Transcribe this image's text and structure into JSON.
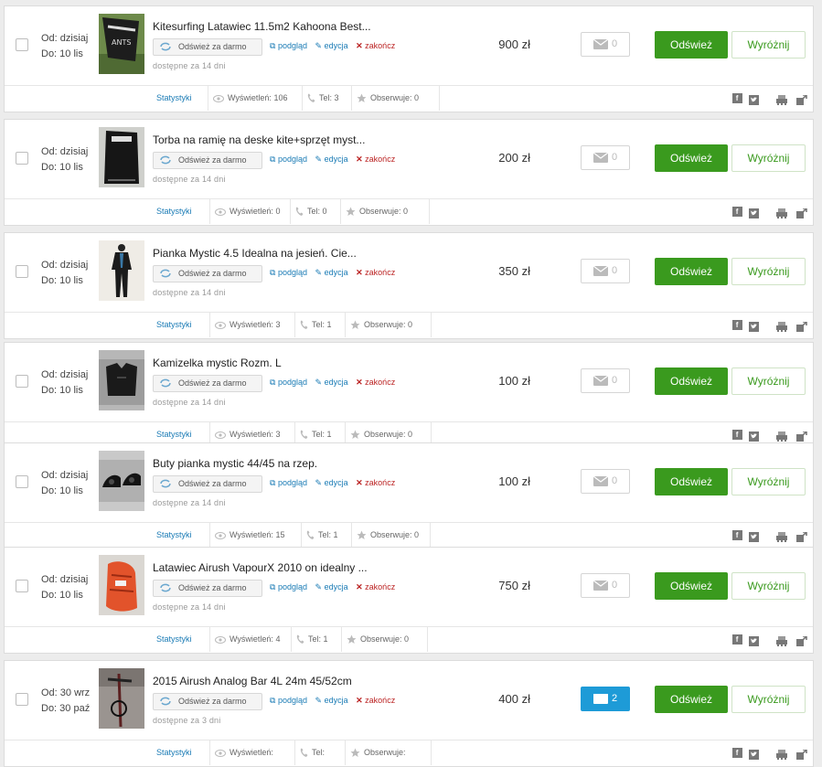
{
  "labels": {
    "refresh_free": "Odśwież za darmo",
    "preview": "podgląd",
    "edit": "edycja",
    "end": "zakończ",
    "refresh_btn": "Odśwież",
    "feature_btn": "Wyróżnij",
    "stats_link": "Statystyki",
    "views_label": "Wyświetleń:",
    "phone_label": "Tel:",
    "watch_label": "Obserwuje:",
    "facebook_glyph": "f"
  },
  "colors": {
    "refresh_green": "#3a9a1e",
    "message_blue": "#1e9bd7",
    "link_blue": "#1a7bb5",
    "end_red": "#b22222"
  },
  "listings": [
    {
      "date_from": "Od: dzisiaj",
      "date_to": "Do: 10 lis",
      "title": "Kitesurfing Latawiec 11.5m2 Kahoona Best...",
      "availability": "dostępne za 14 dni",
      "price": "900 zł",
      "messages": "0",
      "messages_unread": false,
      "views": "106",
      "phone": "3",
      "watchers": "0",
      "thumb_icon": "kite-photo"
    },
    {
      "date_from": "Od: dzisiaj",
      "date_to": "Do: 10 lis",
      "title": "Torba na ramię na deske kite+sprzęt myst...",
      "availability": "dostępne za 14 dni",
      "price": "200 zł",
      "messages": "0",
      "messages_unread": false,
      "views": "0",
      "phone": "0",
      "watchers": "0",
      "thumb_icon": "bag-photo"
    },
    {
      "date_from": "Od: dzisiaj",
      "date_to": "Do: 10 lis",
      "title": "Pianka Mystic 4.5 Idealna na jesień. Cie...",
      "availability": "dostępne za 14 dni",
      "price": "350 zł",
      "messages": "0",
      "messages_unread": false,
      "views": "3",
      "phone": "1",
      "watchers": "0",
      "thumb_icon": "wetsuit-photo"
    },
    {
      "date_from": "Od: dzisiaj",
      "date_to": "Do: 10 lis",
      "title": "Kamizelka mystic Rozm. L",
      "availability": "dostępne za 14 dni",
      "price": "100 zł",
      "messages": "0",
      "messages_unread": false,
      "views": "3",
      "phone": "1",
      "watchers": "0",
      "thumb_icon": "vest-photo"
    },
    {
      "date_from": "Od: dzisiaj",
      "date_to": "Do: 10 lis",
      "title": "Buty pianka mystic 44/45 na rzep.",
      "availability": "dostępne za 14 dni",
      "price": "100 zł",
      "messages": "0",
      "messages_unread": false,
      "views": "15",
      "phone": "1",
      "watchers": "0",
      "thumb_icon": "boots-photo"
    },
    {
      "date_from": "Od: dzisiaj",
      "date_to": "Do: 10 lis",
      "title": "Latawiec Airush VapourX 2010 on idealny ...",
      "availability": "dostępne za 14 dni",
      "price": "750 zł",
      "messages": "0",
      "messages_unread": false,
      "views": "4",
      "phone": "1",
      "watchers": "0",
      "thumb_icon": "kite-bag-photo"
    },
    {
      "date_from": "Od: 30 wrz",
      "date_to": "Do: 30 paź",
      "title": "2015 Airush Analog Bar 4L 24m 45/52cm",
      "availability": "dostępne za 3 dni",
      "price": "400 zł",
      "messages": "2",
      "messages_unread": true,
      "views": "",
      "phone": "",
      "watchers": "",
      "thumb_icon": "bar-photo"
    }
  ]
}
